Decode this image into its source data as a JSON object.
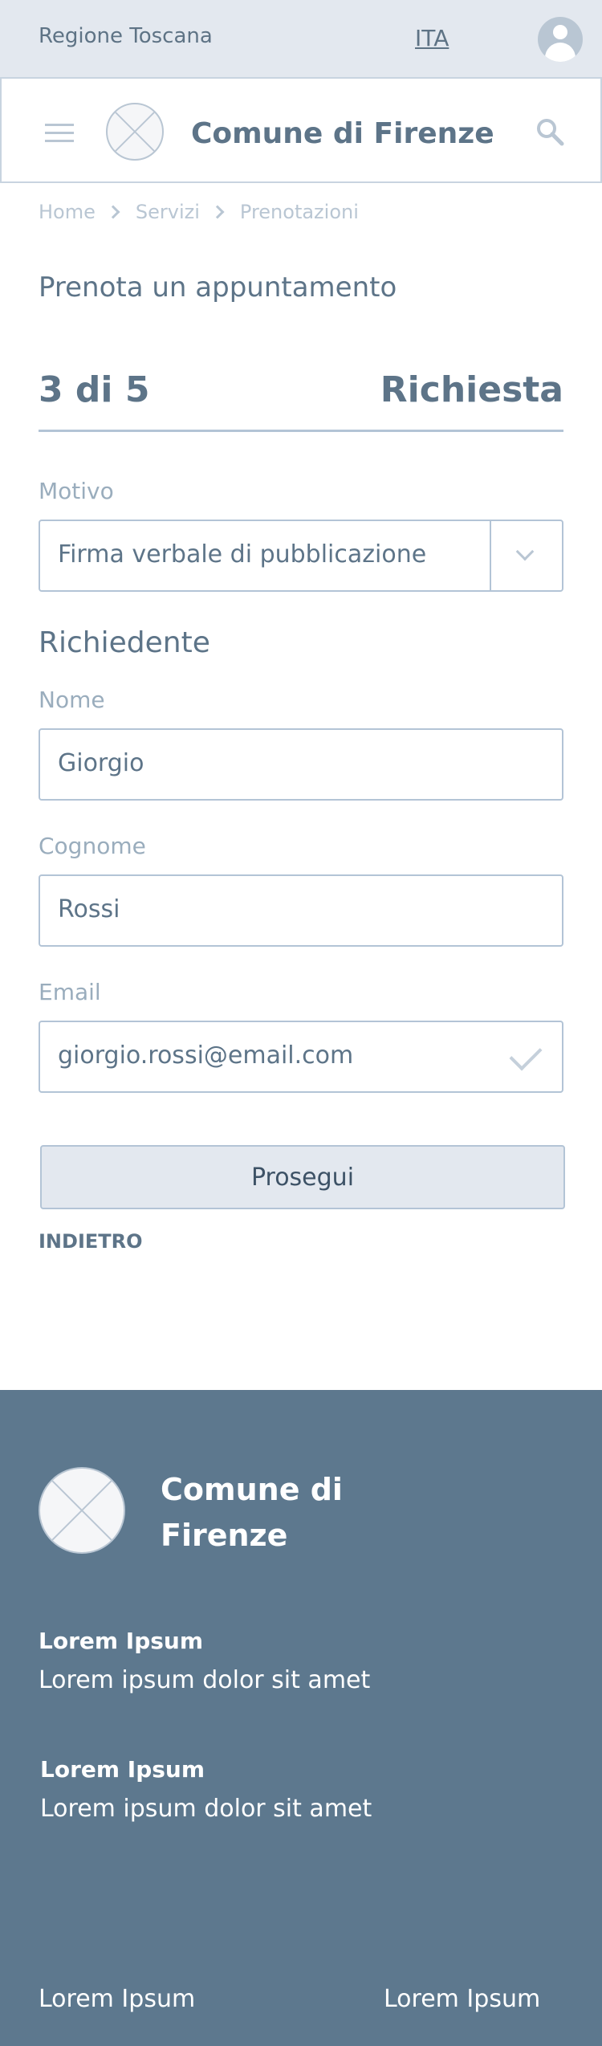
{
  "slim_header": {
    "region": "Regione Toscana",
    "language": "ITA"
  },
  "header": {
    "site_name": "Comune di Firenze"
  },
  "breadcrumb": [
    "Home",
    "Servizi",
    "Prenotazioni"
  ],
  "page": {
    "title": "Prenota un appuntamento"
  },
  "steps": {
    "position": "3 di 5",
    "name": "Richiesta",
    "current": 3,
    "total": 5
  },
  "form": {
    "reason": {
      "label": "Motivo",
      "value": "Firma verbale di pubblicazione"
    },
    "requester_title": "Richiedente",
    "first_name": {
      "label": "Nome",
      "value": "Giorgio"
    },
    "last_name": {
      "label": "Cognome",
      "value": "Rossi"
    },
    "email": {
      "label": "Email",
      "value": "giorgio.rossi@email.com"
    },
    "submit_label": "Prosegui",
    "back_label": "INDIETRO"
  },
  "footer": {
    "site_name": "Comune di Firenze",
    "blocks": [
      {
        "heading": "Lorem Ipsum",
        "text": "Lorem ipsum dolor sit amet"
      },
      {
        "heading": "Lorem Ipsum",
        "text": "Lorem ipsum dolor sit amet"
      }
    ],
    "links": [
      "Lorem Ipsum",
      "Lorem Ipsum"
    ]
  },
  "colors": {
    "primary_text": "#5d7488",
    "muted": "#9aadbd",
    "border": "#b3c4d6",
    "header_bg": "#e3e8ef",
    "footer_bg": "#5d788e"
  },
  "icons": [
    "avatar-icon",
    "hamburger-icon",
    "logo-placeholder-icon",
    "search-icon",
    "chevron-right-icon",
    "chevron-down-icon",
    "check-icon"
  ]
}
